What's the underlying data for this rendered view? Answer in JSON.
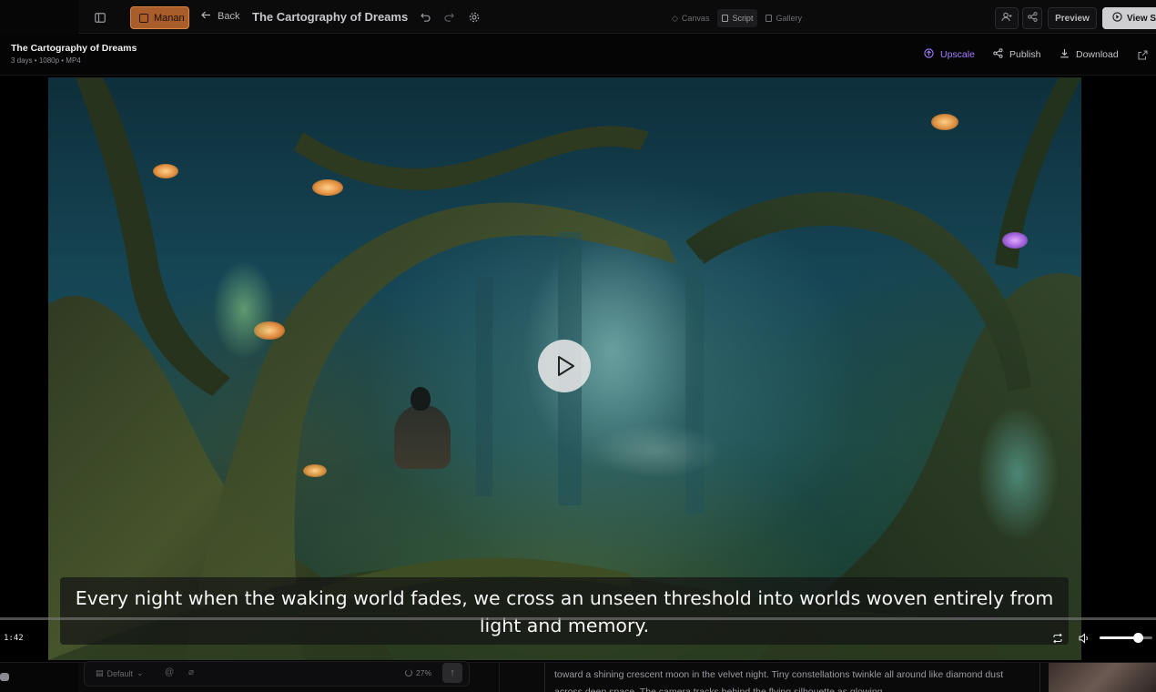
{
  "topbar": {
    "workspace_label": "Manan",
    "back_label": "Back",
    "project_title": "The Cartography of Dreams",
    "views": [
      {
        "label": "Canvas",
        "active": false
      },
      {
        "label": "Script",
        "active": true
      },
      {
        "label": "Gallery",
        "active": false
      }
    ],
    "preview_label": "Preview",
    "view_script_label": "View S",
    "icons": [
      "sidebar-toggle-icon",
      "undo-icon",
      "redo-icon",
      "settings-icon",
      "add-user-icon",
      "share-icon",
      "play-circle-icon"
    ]
  },
  "subheader": {
    "title": "The Cartography of Dreams",
    "meta": "3 days • 1080p • MP4",
    "upscale_label": "Upscale",
    "publish_label": "Publish",
    "download_label": "Download",
    "accent_color": "#a47bff"
  },
  "player": {
    "caption": "Every night when the waking world fades, we cross an unseen threshold into worlds woven entirely from light and memory.",
    "timecode": "1:42",
    "volume": 0.73
  },
  "composer": {
    "model_label": "Default",
    "progress_label": "27%"
  },
  "script_panel": {
    "text": "toward a shining crescent moon in the velvet night. Tiny constellations twinkle all around like diamond dust across deep space. The camera tracks behind the flying silhouette as glowing"
  }
}
